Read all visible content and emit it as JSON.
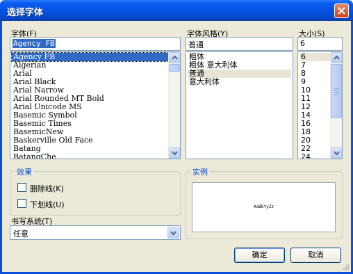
{
  "window": {
    "title": "选择字体"
  },
  "font": {
    "label": "字体(F)",
    "current_value": "Agency FB",
    "items": [
      "Agency FB",
      "Algerian",
      "Arial",
      "Arial Black",
      "Arial Narrow",
      "Arial Rounded MT Bold",
      "Arial Unicode MS",
      "Basemic Symbol",
      "Basemic Times",
      "BasemicNew",
      "Baskerville Old Face",
      "Batang",
      "BatangChe"
    ],
    "selected_index": 0
  },
  "style": {
    "label": "字体风格(Y)",
    "current_value": "普通",
    "items": [
      "粗体",
      "粗体 意大利体",
      "普通",
      "意大利体"
    ],
    "selected_index": 2
  },
  "size": {
    "label": "大小(S)",
    "current_value": "6",
    "items": [
      "6",
      "7",
      "8",
      "9",
      "10",
      "11",
      "12",
      "14",
      "16",
      "18",
      "20",
      "22",
      "24"
    ],
    "selected_index": 0
  },
  "effects": {
    "title": "效果",
    "strikeout_label": "删除线(K)",
    "underline_label": "下划线(U)"
  },
  "sample": {
    "title": "实例",
    "text": "AaBbYyZz"
  },
  "script": {
    "label": "书写系统(T)",
    "value": "任意"
  },
  "buttons": {
    "ok": "确定",
    "cancel": "取消"
  }
}
